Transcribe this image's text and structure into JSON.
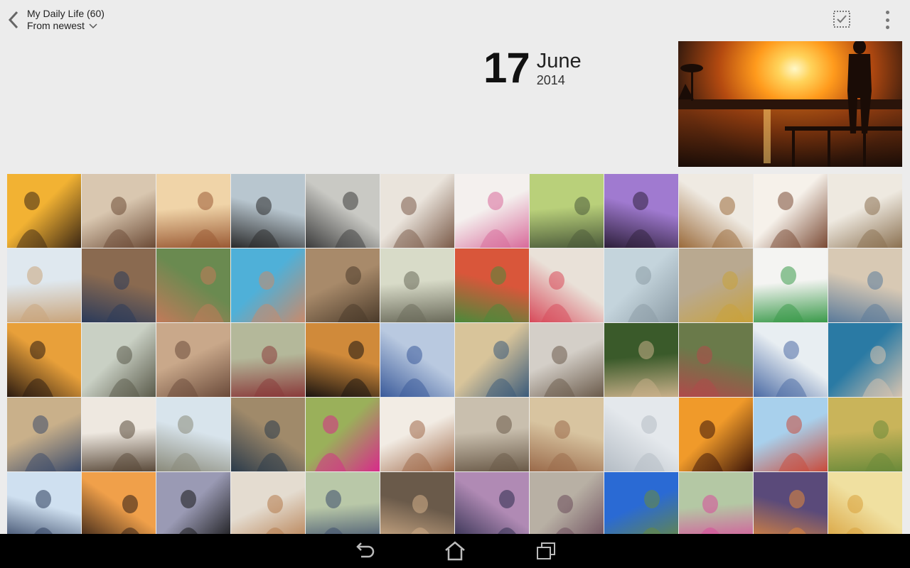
{
  "header": {
    "album_title": "My Daily Life (60)",
    "sort_label": "From newest",
    "back_icon": "back-arrow-icon",
    "select_icon": "select-checkbox-icon",
    "menu_icon": "overflow-menu-icon"
  },
  "date_header": {
    "day": "17",
    "month": "June",
    "year": "2014"
  },
  "featured_photo": {
    "subject": "sunset over water with silhouetted man on pier"
  },
  "photos": [
    {
      "c1": "#f2b233",
      "c2": "#3a2614"
    },
    {
      "c1": "#d9c7b0",
      "c2": "#6b4a35"
    },
    {
      "c1": "#f0d4a8",
      "c2": "#9a5a34"
    },
    {
      "c1": "#b8c6cf",
      "c2": "#2a2a2a"
    },
    {
      "c1": "#c9c9c4",
      "c2": "#3b3b3b"
    },
    {
      "c1": "#eae4dc",
      "c2": "#7a5a48"
    },
    {
      "c1": "#f4f0ee",
      "c2": "#d86a9a"
    },
    {
      "c1": "#b9d07a",
      "c2": "#4b5a3a"
    },
    {
      "c1": "#a07ad0",
      "c2": "#2d1f3a"
    },
    {
      "c1": "#efeae2",
      "c2": "#9a6a3a"
    },
    {
      "c1": "#f6f1ea",
      "c2": "#7a4a34"
    },
    {
      "c1": "#eee9e0",
      "c2": "#8a7050"
    },
    {
      "c1": "#dfe8ef",
      "c2": "#c9a47a"
    },
    {
      "c1": "#8a6a50",
      "c2": "#2a3a5a"
    },
    {
      "c1": "#6a8a50",
      "c2": "#c27a5a"
    },
    {
      "c1": "#4fb0d8",
      "c2": "#c98a6a"
    },
    {
      "c1": "#a88a6a",
      "c2": "#4a3a2a"
    },
    {
      "c1": "#d8dbc8",
      "c2": "#6a6a5a"
    },
    {
      "c1": "#d9563a",
      "c2": "#4a8a3a"
    },
    {
      "c1": "#e9e1d8",
      "c2": "#d84a5a"
    },
    {
      "c1": "#c4d4dc",
      "c2": "#8a9aa4"
    },
    {
      "c1": "#b9a990",
      "c2": "#c9a23a"
    },
    {
      "c1": "#f4f4f2",
      "c2": "#3a9a4a"
    },
    {
      "c1": "#d8c9b4",
      "c2": "#5a7a9a"
    },
    {
      "c1": "#e8a03a",
      "c2": "#2a1a10"
    },
    {
      "c1": "#c9d0c4",
      "c2": "#5a5a4a"
    },
    {
      "c1": "#c9a88a",
      "c2": "#6a4a3a"
    },
    {
      "c1": "#b4b89a",
      "c2": "#8a3a3a"
    },
    {
      "c1": "#d08a3a",
      "c2": "#1a1410"
    },
    {
      "c1": "#b9c9e0",
      "c2": "#3a5a9a"
    },
    {
      "c1": "#d8c49a",
      "c2": "#3a5a7a"
    },
    {
      "c1": "#d4cfc8",
      "c2": "#6a5a4a"
    },
    {
      "c1": "#3a5a2a",
      "c2": "#c9b08a"
    },
    {
      "c1": "#6a7a4a",
      "c2": "#b04a4a"
    },
    {
      "c1": "#e8eef2",
      "c2": "#4a6aa4"
    },
    {
      "c1": "#2a7aa4",
      "c2": "#d8c4b0"
    },
    {
      "c1": "#c9b08a",
      "c2": "#3a4a6a"
    },
    {
      "c1": "#eee8e0",
      "c2": "#5a4a3a"
    },
    {
      "c1": "#d8e4ec",
      "c2": "#8a8a7a"
    },
    {
      "c1": "#a08a6a",
      "c2": "#2a3a4a"
    },
    {
      "c1": "#9ab05a",
      "c2": "#d82a8a"
    },
    {
      "c1": "#f2ece4",
      "c2": "#a06a4a"
    },
    {
      "c1": "#c9bfae",
      "c2": "#6a5a48"
    },
    {
      "c1": "#d8c4a0",
      "c2": "#9a6a4a"
    },
    {
      "c1": "#e4e8ec",
      "c2": "#b4bcc4"
    },
    {
      "c1": "#f09a2a",
      "c2": "#3a1408"
    },
    {
      "c1": "#a8d0ec",
      "c2": "#c94a3a"
    },
    {
      "c1": "#c9b45a",
      "c2": "#6a8a3a"
    },
    {
      "c1": "#cfe0f0",
      "c2": "#2a3a5a"
    },
    {
      "c1": "#f0a04a",
      "c2": "#2a1a14"
    },
    {
      "c1": "#9a9ab4",
      "c2": "#141414"
    },
    {
      "c1": "#e4dcd0",
      "c2": "#b47a4a"
    },
    {
      "c1": "#b9c8a8",
      "c2": "#3a4a6a"
    },
    {
      "c1": "#6a5a4a",
      "c2": "#d4b08a"
    },
    {
      "c1": "#b08ab4",
      "c2": "#2a2a4a"
    },
    {
      "c1": "#b8b0a4",
      "c2": "#6a4a5a"
    },
    {
      "c1": "#2a6ad4",
      "c2": "#6a8a3a"
    },
    {
      "c1": "#b4c8a4",
      "c2": "#d84a9a"
    },
    {
      "c1": "#5a4a7a",
      "c2": "#e48a3a"
    },
    {
      "c1": "#f0e0a0",
      "c2": "#d8a03a"
    }
  ],
  "nav": {
    "back_icon": "nav-back-icon",
    "home_icon": "nav-home-icon",
    "recents_icon": "nav-recents-icon"
  }
}
